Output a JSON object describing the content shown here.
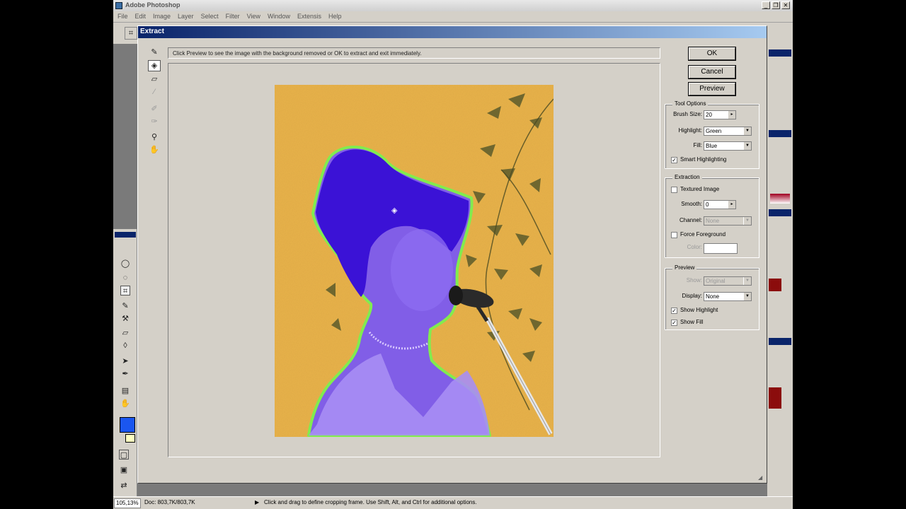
{
  "app": {
    "title": "Adobe Photoshop",
    "window_buttons": [
      "_",
      "❐",
      "✕"
    ]
  },
  "menu": [
    "File",
    "Edit",
    "Image",
    "Layer",
    "Select",
    "Filter",
    "View",
    "Window",
    "Extensis",
    "Help"
  ],
  "dialog": {
    "title": "Extract",
    "hint": "Click Preview to see the image with the background removed or OK to extract and exit immediately.",
    "buttons": {
      "ok": "OK",
      "cancel": "Cancel",
      "preview": "Preview"
    },
    "tool_options": {
      "legend": "Tool Options",
      "brush_size_label": "Brush Size:",
      "brush_size": "20",
      "highlight_label": "Highlight:",
      "highlight": "Green",
      "fill_label": "Fill:",
      "fill": "Blue",
      "smart_highlighting_label": "Smart Highlighting",
      "smart_highlighting": true
    },
    "extraction": {
      "legend": "Extraction",
      "textured_image_label": "Textured Image",
      "textured_image": false,
      "smooth_label": "Smooth:",
      "smooth": "0",
      "channel_label": "Channel:",
      "channel": "None",
      "force_foreground_label": "Force Foreground",
      "force_foreground": false,
      "color_label": "Color:"
    },
    "preview_group": {
      "legend": "Preview",
      "show_label": "Show:",
      "show": "Original",
      "display_label": "Display:",
      "display": "None",
      "show_highlight_label": "Show Highlight",
      "show_highlight": true,
      "show_fill_label": "Show Fill",
      "show_fill": true
    }
  },
  "status": {
    "zoom": "105,13%",
    "doc": "Doc: 803,7K/803,7K",
    "hint": "Click and drag to define cropping frame. Use Shift, Alt, and Ctrl for additional options."
  },
  "colors": {
    "foreground_swatch": "#1a56f0",
    "background_swatch": "#ffffc0",
    "dialog_title_start": "#0a246a",
    "highlight": "#7cf050",
    "fill": "#5a3fd8"
  },
  "icons": {
    "dialog_tools": [
      "edge-highlighter-icon",
      "fill-icon",
      "eraser-icon",
      "eyedropper-icon",
      "cleanup-icon",
      "edge-touchup-icon",
      "zoom-icon",
      "hand-icon"
    ]
  }
}
